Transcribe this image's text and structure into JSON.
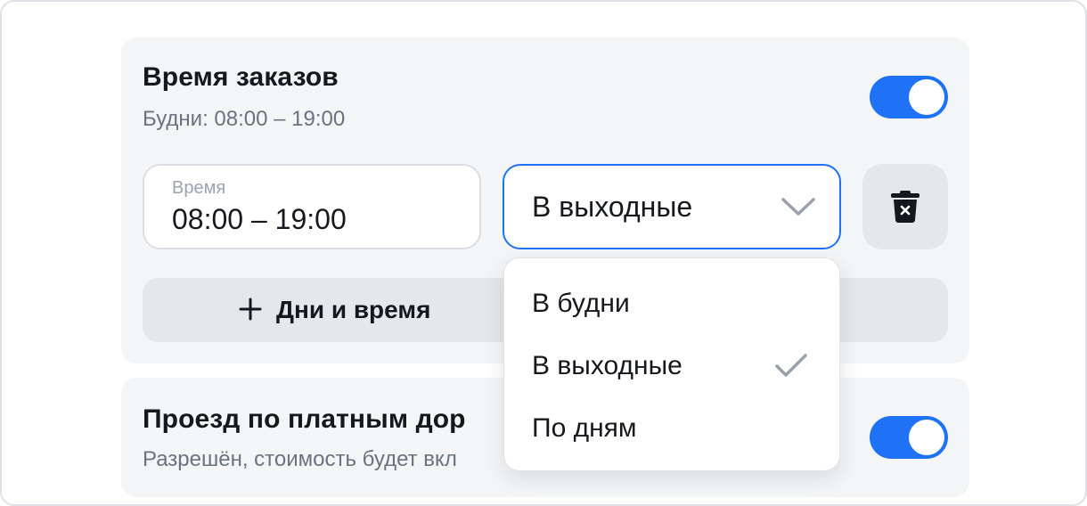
{
  "orders_card": {
    "title": "Время заказов",
    "subtitle": "Будни: 08:00 – 19:00",
    "toggle_on": true
  },
  "time_field": {
    "label": "Время",
    "value": "08:00 – 19:00"
  },
  "day_select": {
    "selected": "В выходные",
    "options": [
      "В будни",
      "В выходные",
      "По дням"
    ],
    "selected_index": 1
  },
  "add_button": {
    "label": "Дни и время"
  },
  "toll_card": {
    "title": "Проезд по платным дор",
    "subtitle": "Разрешён, стоимость будет вкл",
    "toggle_on": true
  },
  "icons": {
    "chevron": "chevron-down-icon",
    "trash": "trash-icon",
    "plus": "plus-icon",
    "check": "check-icon"
  },
  "colors": {
    "accent": "#1f72f6",
    "card_bg": "#f4f5f7",
    "button_bg": "#e6e7ea",
    "muted_text": "#6b7280",
    "chevron": "#9aa1ad"
  }
}
